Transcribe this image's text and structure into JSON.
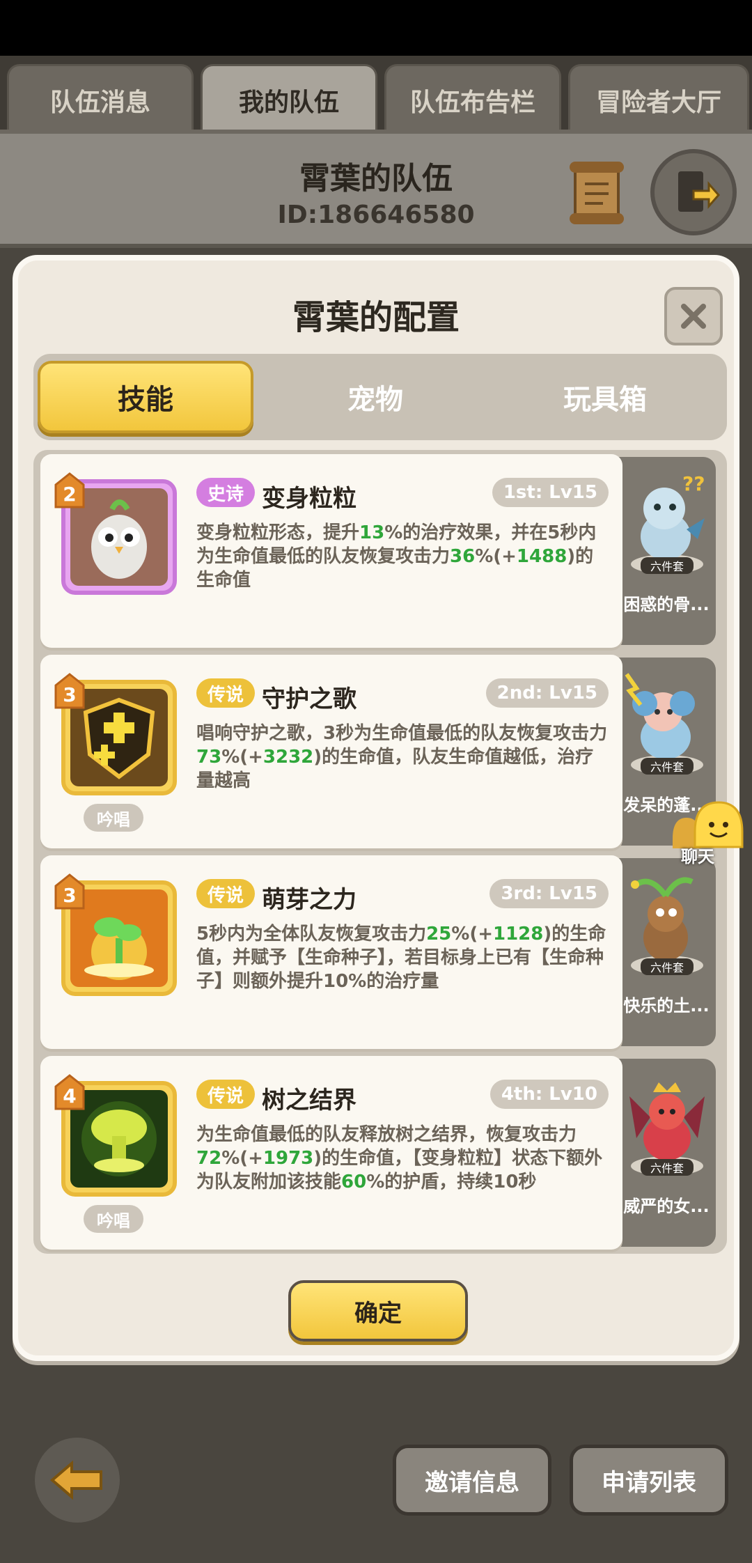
{
  "top_tabs": [
    {
      "label": "队伍消息"
    },
    {
      "label": "我的队伍"
    },
    {
      "label": "队伍布告栏"
    },
    {
      "label": "冒险者大厅"
    }
  ],
  "team": {
    "name": "霄葉的队伍",
    "id": "ID:186646580"
  },
  "panel": {
    "title": "霄葉的配置",
    "tabs": [
      {
        "label": "技能"
      },
      {
        "label": "宠物"
      },
      {
        "label": "玩具箱"
      }
    ],
    "confirm_label": "确定"
  },
  "skills": [
    {
      "level": "2",
      "rarity": "史诗",
      "name": "变身粒粒",
      "slot": "1st: Lv15",
      "desc": [
        "变身粒粒形态，提升",
        "13",
        "%的治疗效果，并在5秒内为生命值最低的队友恢复攻击力",
        "36",
        "%(+",
        "1488",
        ")的生命值"
      ],
      "cast": "",
      "pet": {
        "name": "困惑的骨...",
        "set": "六件套"
      }
    },
    {
      "level": "3",
      "rarity": "传说",
      "name": "守护之歌",
      "slot": "2nd: Lv15",
      "desc": [
        "唱响守护之歌，3秒为生命值最低的队友恢复攻击力",
        "73",
        "%(+",
        "3232",
        ")的生命值，队友生命值越低，治疗量越高"
      ],
      "cast": "吟唱",
      "pet": {
        "name": "发呆的蓬...",
        "set": "六件套"
      }
    },
    {
      "level": "3",
      "rarity": "传说",
      "name": "萌芽之力",
      "slot": "3rd: Lv15",
      "desc": [
        "5秒内为全体队友恢复攻击力",
        "25",
        "%(+",
        "1128",
        ")的生命值，并赋予【生命种子】，若目标身上已有【生命种子】则额外提升10%的治疗量"
      ],
      "cast": "",
      "pet": {
        "name": "快乐的土...",
        "set": "六件套"
      }
    },
    {
      "level": "4",
      "rarity": "传说",
      "name": "树之结界",
      "slot": "4th: Lv10",
      "desc": [
        "为生命值最低的队友释放树之结界，恢复攻击力",
        "72",
        "%(+",
        "1973",
        ")的生命值，【变身粒粒】状态下额外为队友附加该技能",
        "60",
        "%的护盾，持续10秒"
      ],
      "cast": "吟唱",
      "pet": {
        "name": "威严的女...",
        "set": "六件套"
      }
    }
  ],
  "chat": {
    "label": "聊天"
  },
  "bottom": {
    "invite_label": "邀请信息",
    "apply_label": "申请列表"
  }
}
